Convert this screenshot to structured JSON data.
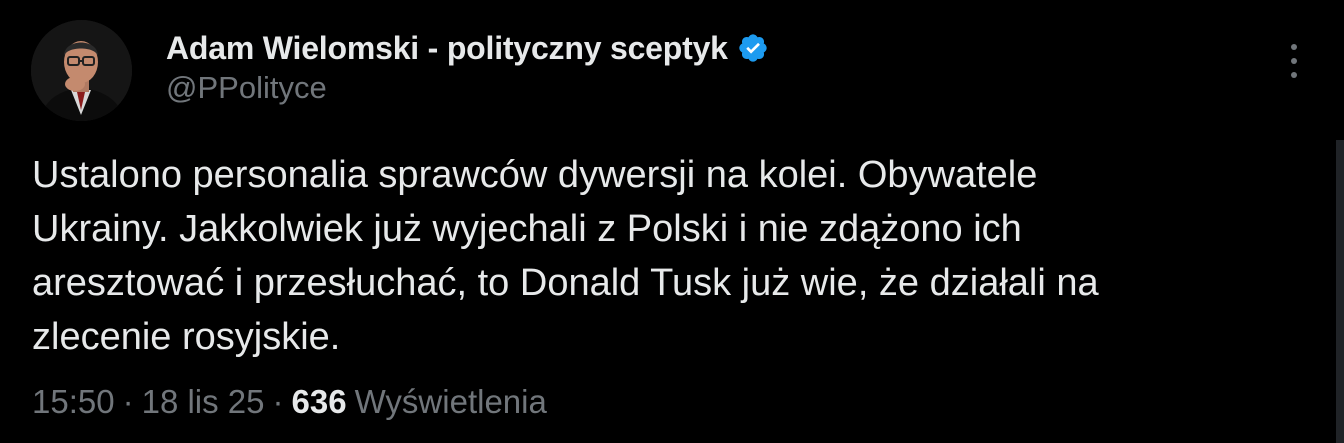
{
  "author": {
    "display_name": "Adam Wielomski - polityczny sceptyk",
    "handle": "@PPolityce",
    "verified": true,
    "verified_badge_color": "#1d9bf0",
    "avatar_icon": "profile-photo"
  },
  "tweet": {
    "text_lines": [
      "Ustalono personalia sprawców dywersji na kolei. Obywatele",
      "Ukrainy. Jakkolwiek już wyjechali z Polski i nie zdążono ich",
      "aresztować i przesłuchać, to Donald Tusk już wie, że działali na",
      "zlecenie rosyjskie."
    ]
  },
  "meta": {
    "time": "15:50",
    "separator": "·",
    "date": "18 lis 25",
    "views_count": "636",
    "views_label": "Wyświetlenia"
  },
  "menu": {
    "icon": "more-vertical-icon"
  },
  "colors": {
    "background": "#000000",
    "text_primary": "#e7e9ea",
    "text_secondary": "#71767b"
  }
}
